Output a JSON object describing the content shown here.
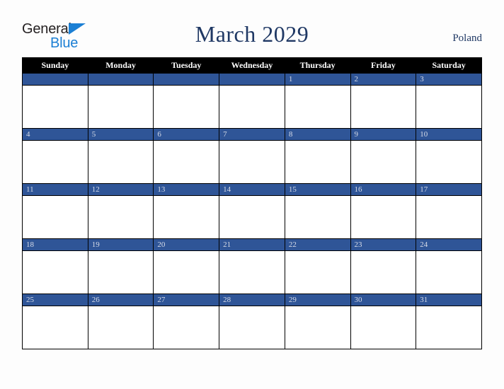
{
  "brand": {
    "word_one": "General",
    "word_two": "Blue",
    "triangle_icon": "blue-triangle-icon",
    "color_dark": "#231f20",
    "color_blue": "#1b7fd4"
  },
  "header": {
    "title": "March 2029",
    "country": "Poland",
    "title_color": "#1f3864"
  },
  "calendar": {
    "weekdays": [
      "Sunday",
      "Monday",
      "Tuesday",
      "Wednesday",
      "Thursday",
      "Friday",
      "Saturday"
    ],
    "header_bg": "#000000",
    "header_fg": "#ffffff",
    "daybar_bg": "#2f5597",
    "daybar_fg": "#d7dce8",
    "cell_bg": "#ffffff",
    "border_color": "#000000",
    "weeks": [
      {
        "days": [
          {
            "num": "",
            "filled": false
          },
          {
            "num": "",
            "filled": false
          },
          {
            "num": "",
            "filled": false
          },
          {
            "num": "",
            "filled": false
          },
          {
            "num": "1",
            "filled": true
          },
          {
            "num": "2",
            "filled": true
          },
          {
            "num": "3",
            "filled": true
          }
        ]
      },
      {
        "days": [
          {
            "num": "4",
            "filled": true
          },
          {
            "num": "5",
            "filled": true
          },
          {
            "num": "6",
            "filled": true
          },
          {
            "num": "7",
            "filled": true
          },
          {
            "num": "8",
            "filled": true
          },
          {
            "num": "9",
            "filled": true
          },
          {
            "num": "10",
            "filled": true
          }
        ]
      },
      {
        "days": [
          {
            "num": "11",
            "filled": true
          },
          {
            "num": "12",
            "filled": true
          },
          {
            "num": "13",
            "filled": true
          },
          {
            "num": "14",
            "filled": true
          },
          {
            "num": "15",
            "filled": true
          },
          {
            "num": "16",
            "filled": true
          },
          {
            "num": "17",
            "filled": true
          }
        ]
      },
      {
        "days": [
          {
            "num": "18",
            "filled": true
          },
          {
            "num": "19",
            "filled": true
          },
          {
            "num": "20",
            "filled": true
          },
          {
            "num": "21",
            "filled": true
          },
          {
            "num": "22",
            "filled": true
          },
          {
            "num": "23",
            "filled": true
          },
          {
            "num": "24",
            "filled": true
          }
        ]
      },
      {
        "days": [
          {
            "num": "25",
            "filled": true
          },
          {
            "num": "26",
            "filled": true
          },
          {
            "num": "27",
            "filled": true
          },
          {
            "num": "28",
            "filled": true
          },
          {
            "num": "29",
            "filled": true
          },
          {
            "num": "30",
            "filled": true
          },
          {
            "num": "31",
            "filled": true
          }
        ]
      }
    ]
  },
  "page": {
    "background": "#fdfdfd"
  }
}
